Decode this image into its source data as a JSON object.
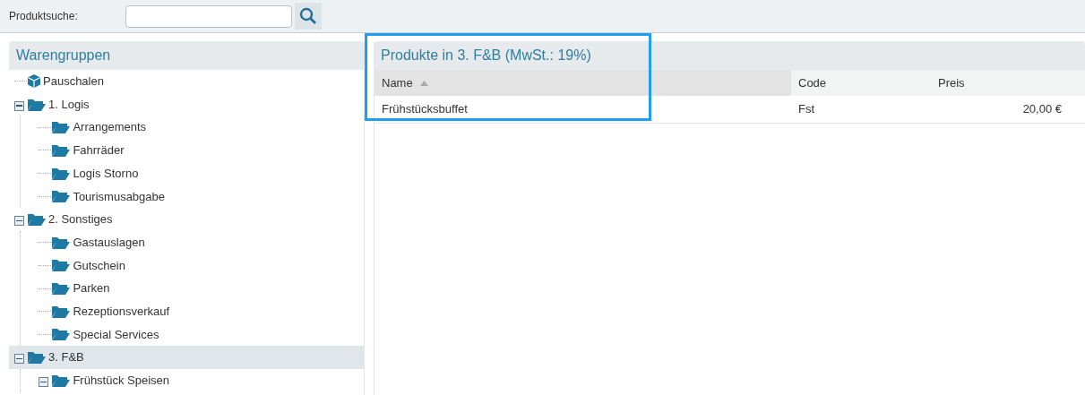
{
  "search": {
    "label": "Produktsuche:"
  },
  "groups_panel": {
    "title": "Warengruppen"
  },
  "tree": [
    {
      "kind": "package",
      "label": "Pauschalen",
      "selected": false
    },
    {
      "kind": "folder",
      "label": "1. Logis",
      "selected": false,
      "expanded": true,
      "children": [
        {
          "kind": "folder",
          "label": "Arrangements",
          "selected": false
        },
        {
          "kind": "folder",
          "label": "Fahrräder",
          "selected": false
        },
        {
          "kind": "folder",
          "label": "Logis Storno",
          "selected": false
        },
        {
          "kind": "folder",
          "label": "Tourismusabgabe",
          "selected": false
        }
      ]
    },
    {
      "kind": "folder",
      "label": "2. Sonstiges",
      "selected": false,
      "expanded": true,
      "children": [
        {
          "kind": "folder",
          "label": "Gastauslagen",
          "selected": false
        },
        {
          "kind": "folder",
          "label": "Gutschein",
          "selected": false
        },
        {
          "kind": "folder",
          "label": "Parken",
          "selected": false
        },
        {
          "kind": "folder",
          "label": "Rezeptionsverkauf",
          "selected": false
        },
        {
          "kind": "folder",
          "label": "Special Services",
          "selected": false
        }
      ]
    },
    {
      "kind": "folder",
      "label": "3. F&B",
      "selected": true,
      "expanded": true,
      "children": [
        {
          "kind": "folder",
          "label": "Frühstück Speisen",
          "selected": false,
          "expanded": true
        }
      ]
    }
  ],
  "products_panel": {
    "title": "Produkte in 3. F&B (MwSt.: 19%)",
    "highlighted": true,
    "columns": [
      {
        "label": "Name",
        "sorted": true
      },
      {
        "label": "Code",
        "sorted": false
      },
      {
        "label": "Preis",
        "sorted": false
      }
    ],
    "rows": [
      {
        "name": "Frühstücksbuffet",
        "code": "Fst",
        "price": "20,00 €"
      }
    ]
  }
}
